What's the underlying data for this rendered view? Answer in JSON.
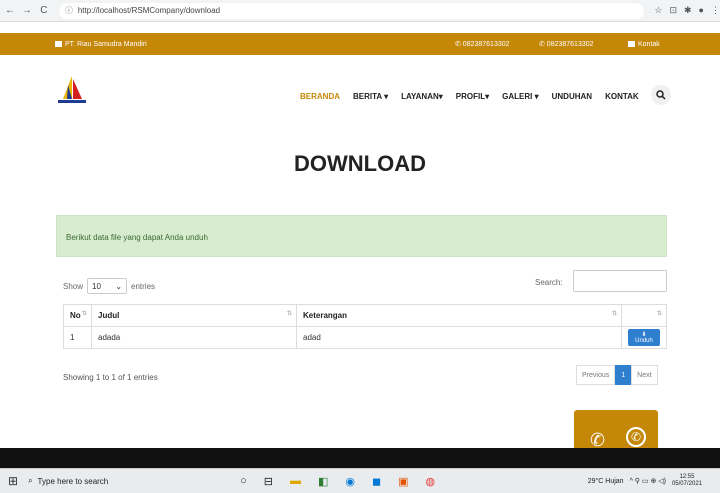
{
  "browser": {
    "url": "http://localhost/RSMCompany/download",
    "back": "←",
    "forward": "→",
    "reload": "C",
    "info_icon": "ⓘ",
    "toolbar_icons": [
      "☆",
      "⊡",
      "✱",
      "●",
      "⋮"
    ]
  },
  "topbar": {
    "company": "PT. Riau Samudra Mandiri",
    "phone1": "✆ 082387613302",
    "phone2": "✆ 082387613302",
    "contact": "Kontak"
  },
  "menu": {
    "items": [
      "BERANDA",
      "BERITA ▾",
      "LAYANAN▾",
      "PROFIL▾",
      "GALERI ▾",
      "UNDUHAN",
      "KONTAK"
    ],
    "search_icon": "🔍"
  },
  "page": {
    "title": "DOWNLOAD",
    "alert": "Berikut data file yang dapat Anda unduh"
  },
  "table": {
    "show_label": "Show",
    "entries_label": "entries",
    "page_length": "10",
    "search_label": "Search:",
    "columns": [
      "No",
      "Judul",
      "Keterangan",
      ""
    ],
    "rows": [
      {
        "no": "1",
        "judul": "adada",
        "keterangan": "adad",
        "action": "⬇ Unduh"
      }
    ],
    "info": "Showing 1 to 1 of 1 entries",
    "pager": {
      "previous": "Previous",
      "current": "1",
      "next": "Next"
    }
  },
  "floating": {
    "phone": "✆",
    "whatsapp": "✆"
  },
  "taskbar": {
    "start": "⊞",
    "search_placeholder": "Type here to search",
    "search_icon": "⌕",
    "apps": [
      "○",
      "⊟",
      "▬",
      "◧",
      "◉",
      "◼",
      "▣",
      "◍"
    ],
    "weather": "29°C Hujan",
    "time": "12:55",
    "date": "05/07/2021",
    "tray_icons": "^ ⚲ ▭ ⊕ ◁)"
  },
  "colors": {
    "brand": "#c48708",
    "accent": "#2f7fcf",
    "alert_bg": "#d8ecd0"
  }
}
